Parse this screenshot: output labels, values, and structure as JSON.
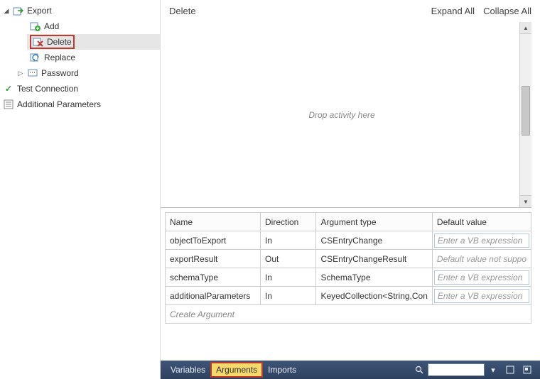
{
  "sidebar": {
    "root": {
      "label": "Export",
      "children": [
        {
          "label": "Add"
        },
        {
          "label": "Delete",
          "selected": true,
          "highlighted": true
        },
        {
          "label": "Replace"
        }
      ]
    },
    "siblings": [
      {
        "label": "Password",
        "expandable": true
      },
      {
        "label": "Test Connection",
        "check": true
      },
      {
        "label": "Additional Parameters"
      }
    ]
  },
  "designer": {
    "title": "Delete",
    "expand_all": "Expand All",
    "collapse_all": "Collapse All",
    "drop_hint": "Drop activity here"
  },
  "arguments": {
    "columns": {
      "name": "Name",
      "dir": "Direction",
      "type": "Argument type",
      "def": "Default value"
    },
    "rows": [
      {
        "name": "objectToExport",
        "dir": "In",
        "type": "CSEntryChange",
        "def": "Enter a VB expression",
        "editable": true
      },
      {
        "name": "exportResult",
        "dir": "Out",
        "type": "CSEntryChangeResult",
        "def": "Default value not suppo",
        "editable": false
      },
      {
        "name": "schemaType",
        "dir": "In",
        "type": "SchemaType",
        "def": "Enter a VB expression",
        "editable": true
      },
      {
        "name": "additionalParameters",
        "dir": "In",
        "type": "KeyedCollection<String,Con",
        "def": "Enter a VB expression",
        "editable": true
      }
    ],
    "create": "Create Argument"
  },
  "bottom": {
    "variables": "Variables",
    "arguments": "Arguments",
    "imports": "Imports"
  }
}
